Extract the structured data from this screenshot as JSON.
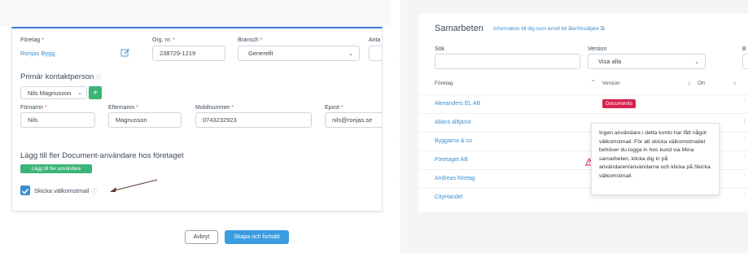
{
  "left": {
    "company_label": "Företag",
    "company_value": "Ronjas Bygg",
    "org_label": "Org. nr.",
    "org_value": "238729-1219",
    "branch_label": "Bransch",
    "branch_value": "Generellt",
    "antal_label": "Anta",
    "primary_contact_title": "Primär kontaktperson",
    "contact_select_value": "Nils Magnusson",
    "add_symbol": "+",
    "firstname_label": "Förnamn",
    "firstname_value": "Nils",
    "lastname_label": "Efternamn",
    "lastname_value": "Magnusson",
    "mobile_label": "Mobilnummer",
    "mobile_value": "0743232923",
    "email_label": "Epost",
    "email_value": "nils@ronjas.se",
    "more_users_title": "Lägg till fler Document-användare hos företaget",
    "add_more_button": "Lägg till fler användare",
    "send_welcome_label": "Skicka välkomstmail",
    "send_welcome_checked": true,
    "required_mark": "*"
  },
  "footer": {
    "cancel_label": "Avbryt",
    "create_label": "Skapa och fortsätt"
  },
  "right": {
    "title": "Samarbeten",
    "info_link": "Information till dig som är/vill bli återförsäljare",
    "search_label": "Sök",
    "search_value": "",
    "version_label": "Version",
    "version_value": "Visa alla",
    "col_b": "B",
    "columns": {
      "company": "Företag",
      "version": "Version",
      "city": "Ort",
      "extra": ""
    },
    "rows": [
      {
        "name": "Alexanders EL AB",
        "version": "Documents"
      },
      {
        "name": "Allans alltjänst",
        "version": ""
      },
      {
        "name": "Byggarna & co",
        "version": ""
      },
      {
        "name": "Företaget AB",
        "version": ""
      },
      {
        "name": "Andreas företag",
        "version": ""
      },
      {
        "name": "CityHandel",
        "version": ""
      }
    ],
    "tooltip": "Ingen användare i detta konto har fått något välkomstmail. För att skicka välkomstmailet behöver du logga in hos kund via Mina samarbeten, klicka dig in på användaren/användarna och klicka på Skicka välkomstmail.",
    "badge_color": "#d6224f"
  }
}
